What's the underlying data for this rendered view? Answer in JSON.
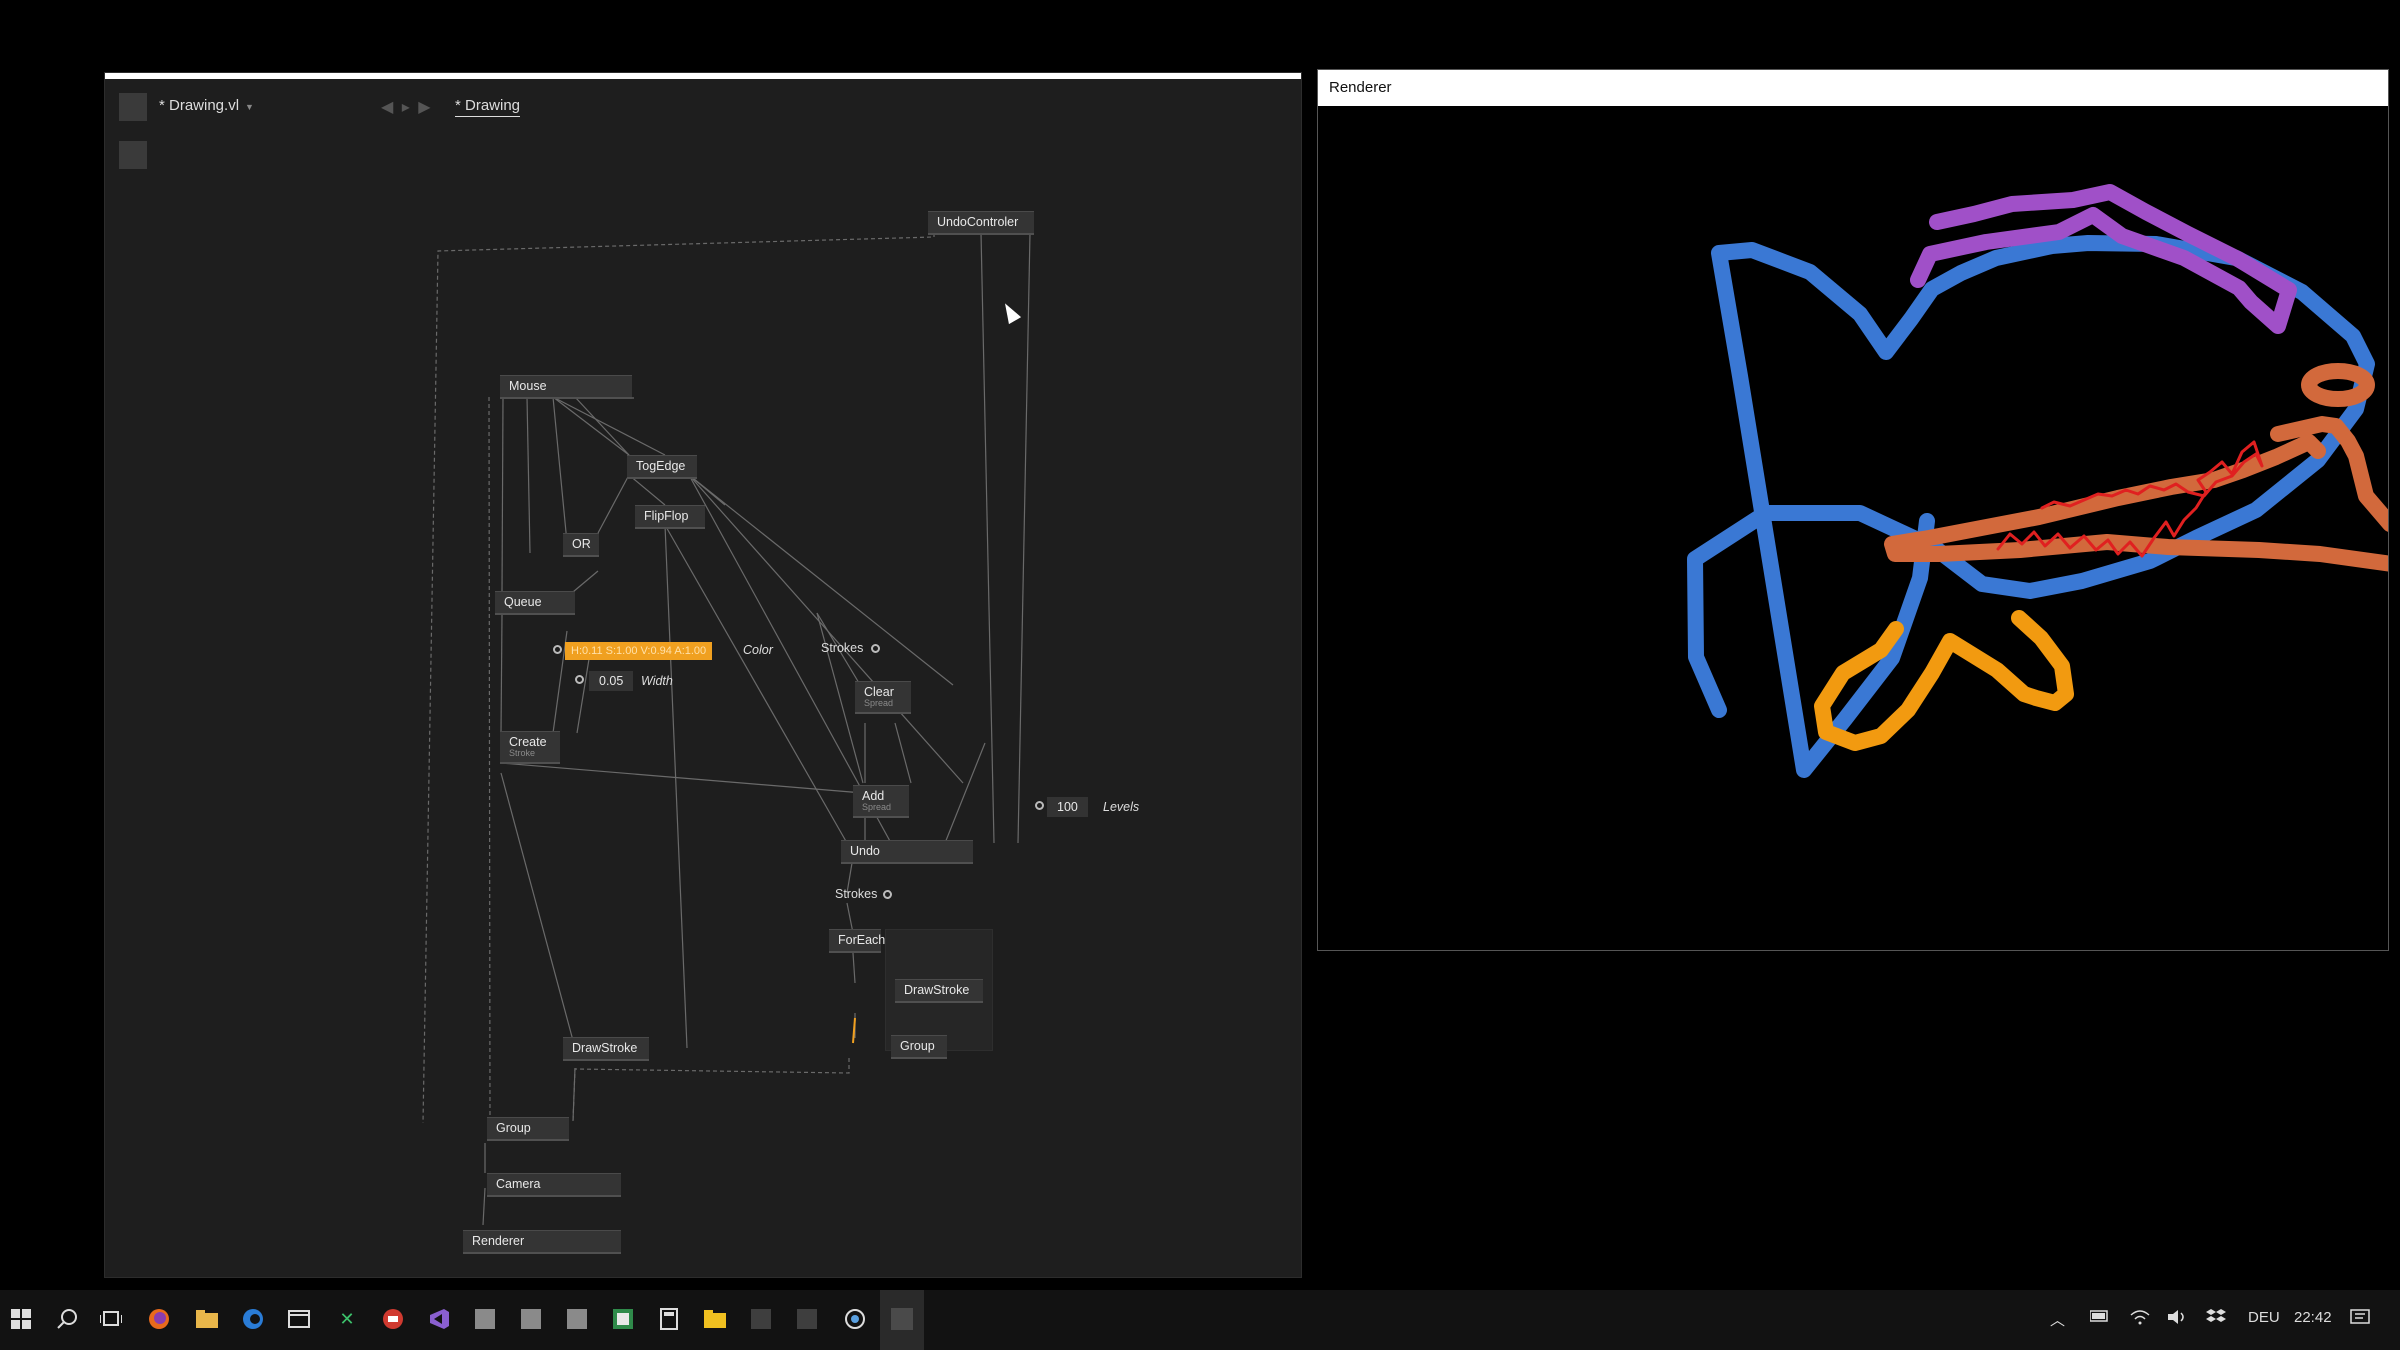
{
  "editor": {
    "file_tab": "* Drawing.vl",
    "patch_tab": "* Drawing",
    "nav_arrows": "◀ ▸ ▶"
  },
  "nodes": {
    "undo_controller": "UndoControler",
    "mouse": "Mouse",
    "togedge": "TogEdge",
    "flipflop": "FlipFlop",
    "or": "OR",
    "queue": "Queue",
    "create": "Create",
    "create_sub": "Stroke",
    "clear": "Clear",
    "clear_sub": "Spread",
    "add": "Add",
    "add_sub": "Spread",
    "undo": "Undo",
    "foreach": "ForEach",
    "drawstroke_inner": "DrawStroke",
    "group_inner": "Group",
    "drawstroke": "DrawStroke",
    "group": "Group",
    "camera": "Camera",
    "renderer": "Renderer"
  },
  "pads": {
    "color_value": "H:0.11 S:1.00 V:0.94 A:1.00",
    "color_label": "Color",
    "width_value": "0.05",
    "width_label": "Width",
    "strokes_label_1": "Strokes",
    "levels_value": "100",
    "levels_label": "Levels",
    "strokes_label_2": "Strokes"
  },
  "renderer": {
    "title": "Renderer",
    "stroke_colors": {
      "body": "#3a78d4",
      "fin": "#a050c8",
      "mouth": "#d2693c",
      "teeth": "#e02020",
      "belly_fin": "#f29a10"
    }
  },
  "taskbar": {
    "icons": [
      "windows-start-icon",
      "search-icon",
      "task-view-icon",
      "firefox-icon",
      "file-explorer-icon",
      "edge-icon",
      "window-icon",
      "xmind-icon",
      "app-red-icon",
      "visual-studio-icon",
      "app-gray-icon",
      "app-gray-icon",
      "app-gray-icon",
      "app-green-icon",
      "calculator-icon",
      "folder-icon",
      "app-dark-icon",
      "app-dark-icon",
      "vvvv-icon",
      "app-active-icon"
    ],
    "language": "DEU",
    "clock": "22:42"
  }
}
